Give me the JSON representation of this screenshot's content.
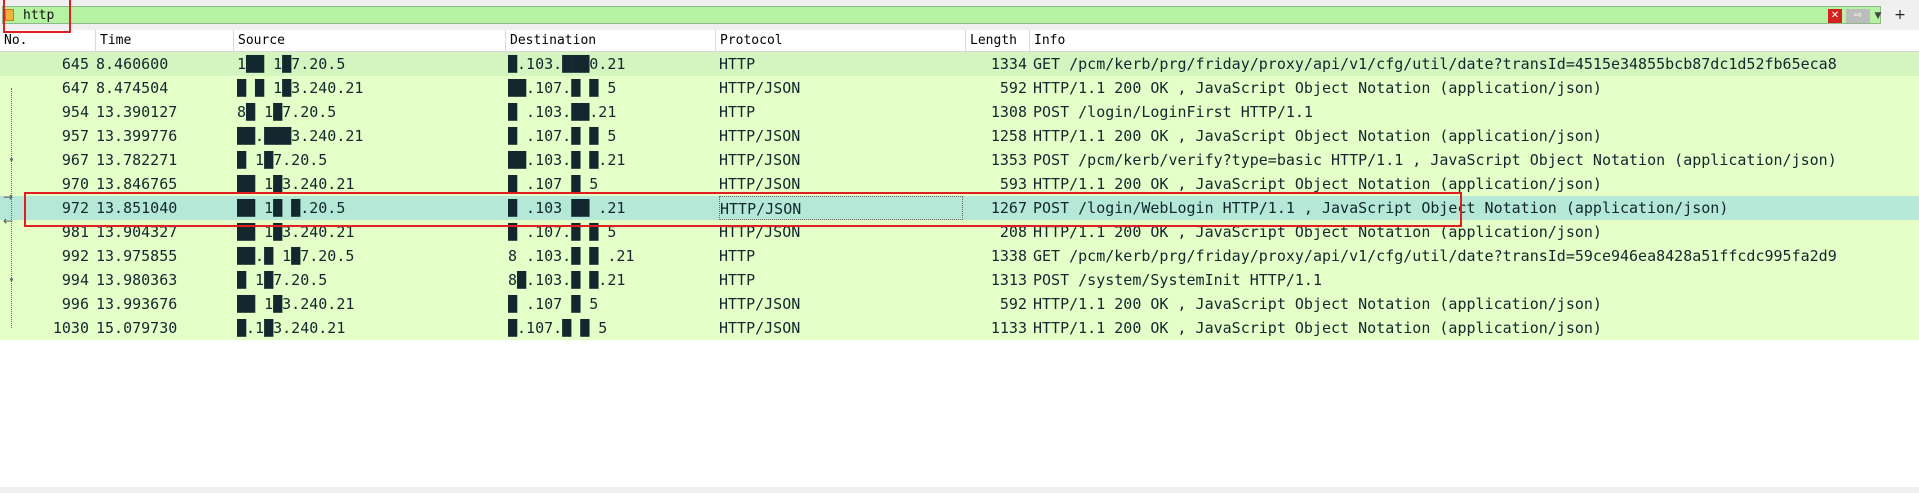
{
  "filter": {
    "value": "http",
    "placeholder": ""
  },
  "icons": {
    "bookmark": "bookmark-icon",
    "clear": "clear-icon",
    "apply": "arrow-right-icon",
    "dropdown": "chevron-down-icon",
    "add": "plus-icon"
  },
  "colors": {
    "filter_valid_bg": "#b5f2a2",
    "http_row": "#e4ffc7",
    "selected_row": "#b5e8d7",
    "annotation": "#e02020",
    "row_text": "#12272e"
  },
  "columns": [
    "No.",
    "Time",
    "Source",
    "Destination",
    "Protocol",
    "Length",
    "Info"
  ],
  "packets": [
    {
      "no": "645",
      "time": "8.460600",
      "source": "1██ 1█7.20.5",
      "destination": "█.103.███0.21",
      "protocol": "HTTP",
      "length": "1334",
      "info": "GET /pcm/kerb/prg/friday/proxy/api/v1/cfg/util/date?transId=4515e34855bcb87dc1d52fb65eca8",
      "state": "hover"
    },
    {
      "no": "647",
      "time": "8.474504",
      "source": "█ █ 1█3.240.21",
      "destination": "██.107.█ █ 5",
      "protocol": "HTTP/JSON",
      "length": "592",
      "info": "HTTP/1.1 200 OK , JavaScript Object Notation (application/json)",
      "state": "normal"
    },
    {
      "no": "954",
      "time": "13.390127",
      "source": "8█ 1█7.20.5",
      "destination": "█ .103.██.21",
      "protocol": "HTTP",
      "length": "1308",
      "info": "POST /login/LoginFirst HTTP/1.1",
      "state": "normal"
    },
    {
      "no": "957",
      "time": "13.399776",
      "source": "██.███3.240.21",
      "destination": "█ .107.█ █ 5",
      "protocol": "HTTP/JSON",
      "length": "1258",
      "info": "HTTP/1.1 200 OK , JavaScript Object Notation (application/json)",
      "state": "normal"
    },
    {
      "no": "967",
      "time": "13.782271",
      "source": "█ 1█7.20.5",
      "destination": "██.103.█ █.21",
      "protocol": "HTTP/JSON",
      "length": "1353",
      "info": "POST /pcm/kerb/verify?type=basic HTTP/1.1 , JavaScript Object Notation (application/json)",
      "state": "normal"
    },
    {
      "no": "970",
      "time": "13.846765",
      "source": "██ 1█3.240.21",
      "destination": "█ .107 █ 5",
      "protocol": "HTTP/JSON",
      "length": "593",
      "info": "HTTP/1.1 200 OK , JavaScript Object Notation (application/json)",
      "state": "normal"
    },
    {
      "no": "972",
      "time": "13.851040",
      "source": "██ 1█ █.20.5",
      "destination": "█ .103 ██ .21",
      "protocol": "HTTP/JSON",
      "length": "1267",
      "info": "POST /login/WebLogin HTTP/1.1 , JavaScript Object Notation (application/json)",
      "state": "selected"
    },
    {
      "no": "981",
      "time": "13.904327",
      "source": "██ 1█3.240.21",
      "destination": "█ .107.█ █ 5",
      "protocol": "HTTP/JSON",
      "length": "208",
      "info": "HTTP/1.1 200 OK , JavaScript Object Notation (application/json)",
      "state": "normal"
    },
    {
      "no": "992",
      "time": "13.975855",
      "source": "██.█ 1█7.20.5",
      "destination": "8 .103.█ █ .21",
      "protocol": "HTTP",
      "length": "1338",
      "info": "GET /pcm/kerb/prg/friday/proxy/api/v1/cfg/util/date?transId=59ce946ea8428a51ffcdc995fa2d9",
      "state": "normal"
    },
    {
      "no": "994",
      "time": "13.980363",
      "source": "█ 1█7.20.5",
      "destination": "8█.103.█ █.21",
      "protocol": "HTTP",
      "length": "1313",
      "info": "POST /system/SystemInit HTTP/1.1",
      "state": "normal"
    },
    {
      "no": "996",
      "time": "13.993676",
      "source": "██ 1█3.240.21",
      "destination": "█ .107 █ 5",
      "protocol": "HTTP/JSON",
      "length": "592",
      "info": "HTTP/1.1 200 OK , JavaScript Object Notation (application/json)",
      "state": "normal"
    },
    {
      "no": "1030",
      "time": "15.079730",
      "source": "█.1█3.240.21",
      "destination": "█.107.█ █ 5",
      "protocol": "HTTP/JSON",
      "length": "1133",
      "info": "HTTP/1.1 200 OK , JavaScript Object Notation (application/json)",
      "state": "normal"
    }
  ]
}
